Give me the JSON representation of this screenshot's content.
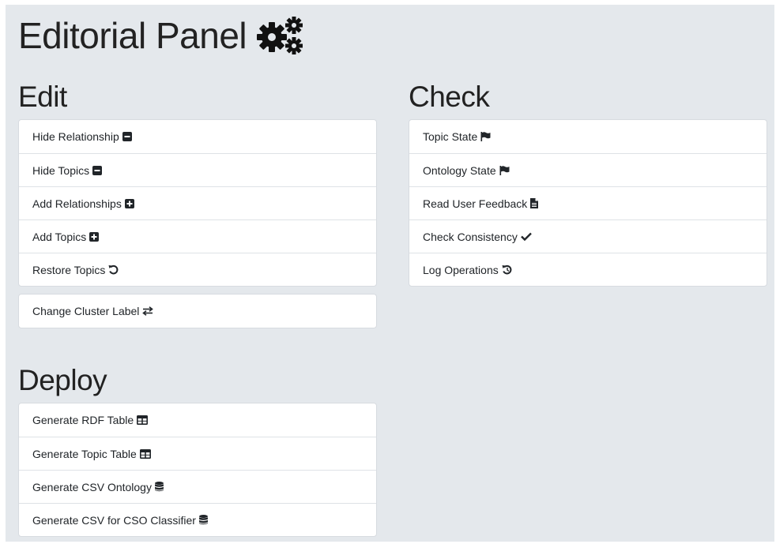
{
  "title": "Editorial Panel",
  "title_icon": "cogs-icon",
  "edit": {
    "heading": "Edit",
    "items": [
      {
        "label": "Hide Relationship",
        "icon": "minus-square-icon"
      },
      {
        "label": "Hide Topics",
        "icon": "minus-square-icon"
      },
      {
        "label": "Add Relationships",
        "icon": "plus-square-icon"
      },
      {
        "label": "Add Topics",
        "icon": "plus-square-icon"
      },
      {
        "label": "Restore Topics",
        "icon": "undo-icon"
      }
    ],
    "extra": {
      "label": "Change Cluster Label",
      "icon": "exchange-icon"
    }
  },
  "check": {
    "heading": "Check",
    "items": [
      {
        "label": "Topic State",
        "icon": "flag-icon"
      },
      {
        "label": "Ontology State",
        "icon": "flag-icon"
      },
      {
        "label": "Read User Feedback",
        "icon": "file-icon"
      },
      {
        "label": "Check Consistency",
        "icon": "check-icon"
      },
      {
        "label": "Log Operations",
        "icon": "history-icon"
      }
    ]
  },
  "deploy": {
    "heading": "Deploy",
    "items": [
      {
        "label": "Generate RDF Table",
        "icon": "table-icon"
      },
      {
        "label": "Generate Topic Table",
        "icon": "table-icon"
      },
      {
        "label": "Generate CSV Ontology",
        "icon": "database-icon"
      },
      {
        "label": "Generate CSV for CSO Classifier",
        "icon": "database-icon"
      }
    ]
  },
  "colors": {
    "background": "#e4e8ec",
    "card": "#ffffff",
    "text": "#212529",
    "border": "#dee2e6"
  }
}
